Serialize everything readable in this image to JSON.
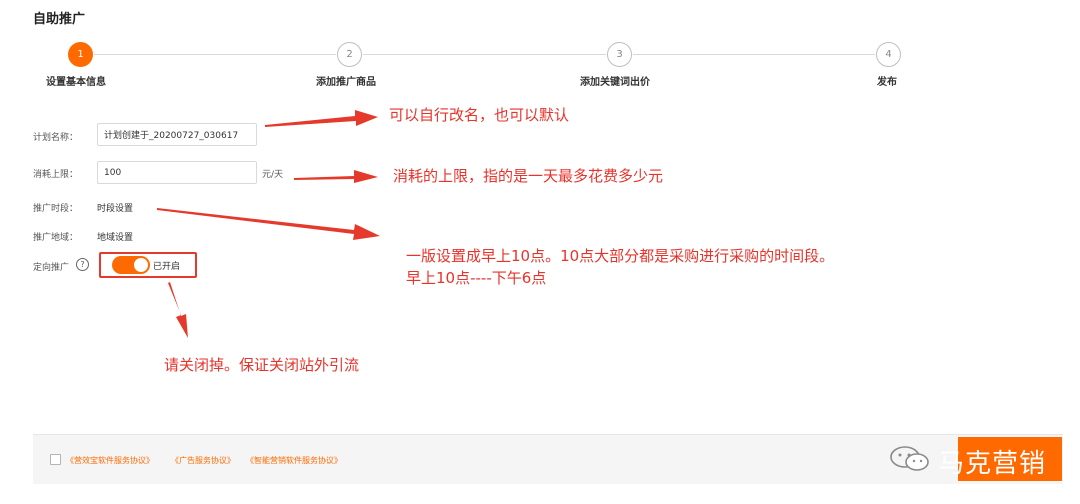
{
  "page": {
    "title": "自助推广"
  },
  "steps": [
    {
      "number": "1",
      "label": "设置基本信息",
      "active": true
    },
    {
      "number": "2",
      "label": "添加推广商品",
      "active": false
    },
    {
      "number": "3",
      "label": "添加关键词出价",
      "active": false
    },
    {
      "number": "4",
      "label": "发布",
      "active": false
    }
  ],
  "form": {
    "plan_name": {
      "label": "计划名称：",
      "value": "计划创建于_20200727_030617"
    },
    "budget": {
      "label": "消耗上限：",
      "value": "100",
      "unit": "元/天"
    },
    "schedule": {
      "label": "推广时段：",
      "value": "时段设置"
    },
    "region": {
      "label": "推广地域：",
      "value": "地域设置"
    },
    "targeting": {
      "label": "定向推广",
      "help_icon": "?",
      "toggle_text": "已开启",
      "enabled": true
    }
  },
  "annotations": {
    "rename": "可以自行改名，也可以默认",
    "budget": "消耗的上限，指的是一天最多花费多少元",
    "schedule_line1": "一版设置成早上10点。10点大部分都是采购进行采购的时间段。",
    "schedule_line2": "早上10点----下午6点",
    "targeting": "请关闭掉。保证关闭站外引流",
    "color": "#e8322a"
  },
  "footer": {
    "agreements": [
      "《营效宝软件服务协议》",
      "《广告服务协议》",
      "《智能营销软件服务协议》"
    ]
  },
  "watermark": {
    "text": "马克营销",
    "icon": "wechat-icon"
  },
  "colors": {
    "accent": "#ff6a00",
    "annotation_red": "#e53a2b"
  }
}
